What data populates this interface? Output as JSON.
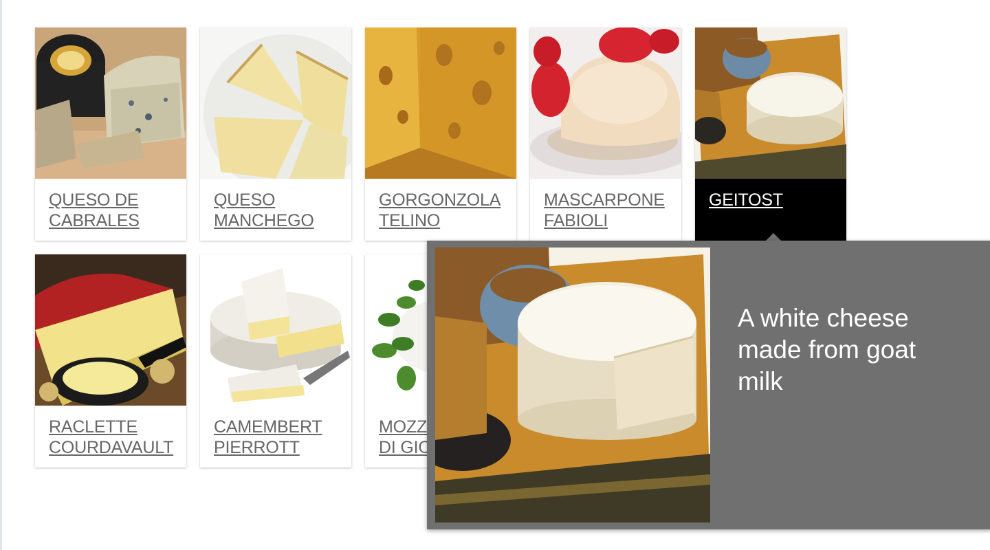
{
  "cheeses": [
    {
      "name_line1": "QUESO DE",
      "name_line2": "CABRALES"
    },
    {
      "name_line1": "QUESO",
      "name_line2": "MANCHEGO"
    },
    {
      "name_line1": "GORGONZOLA",
      "name_line2": "TELINO"
    },
    {
      "name_line1": "MASCARPONE",
      "name_line2": "FABIOLI"
    },
    {
      "name_line1": "GEITOST",
      "name_line2": ""
    },
    {
      "name_line1": "RACLETTE",
      "name_line2": "COURDAVAULT"
    },
    {
      "name_line1": "CAMEMBERT",
      "name_line2": "PIERROTT"
    },
    {
      "name_line1": "MOZZARELLA",
      "name_line2": "DI GIOVANNI"
    }
  ],
  "selected": {
    "name": "GEITOST",
    "description": "A white cheese made from goat milk"
  },
  "colors": {
    "popup_bg": "#707070",
    "active_caption_bg": "#000000",
    "caption_text": "#666666"
  }
}
